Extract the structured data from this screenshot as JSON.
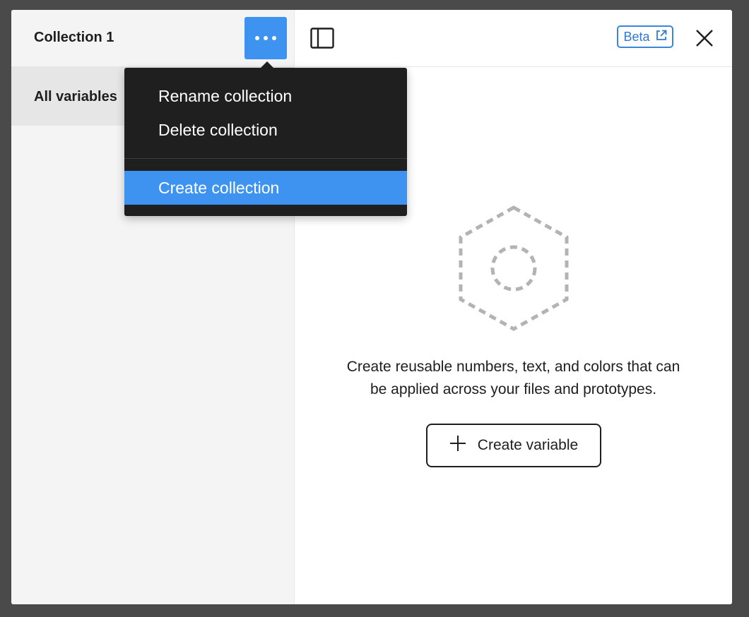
{
  "sidebar": {
    "collection_title": "Collection 1",
    "all_variables_label": "All variables"
  },
  "header": {
    "beta_label": "Beta"
  },
  "menu": {
    "items": [
      {
        "label": "Rename collection"
      },
      {
        "label": "Delete collection"
      },
      {
        "label": "Create collection",
        "highlighted": true
      }
    ]
  },
  "empty_state": {
    "line1": "Create reusable numbers, text, and colors that can",
    "line2": "be applied across your files and prototypes.",
    "button_label": "Create variable"
  },
  "colors": {
    "accent": "#3f93f0",
    "menu_bg": "#1f1f1f",
    "sidebar_bg": "#f4f4f4",
    "selected_bg": "#e6e6e6",
    "beta_blue": "#2f7ad0"
  },
  "icons": {
    "more": "more-horizontal-icon",
    "panel_toggle": "sidebar-panel-icon",
    "external_link": "external-link-icon",
    "close": "close-icon",
    "empty": "hexagon-variable-icon",
    "plus": "plus-icon"
  }
}
